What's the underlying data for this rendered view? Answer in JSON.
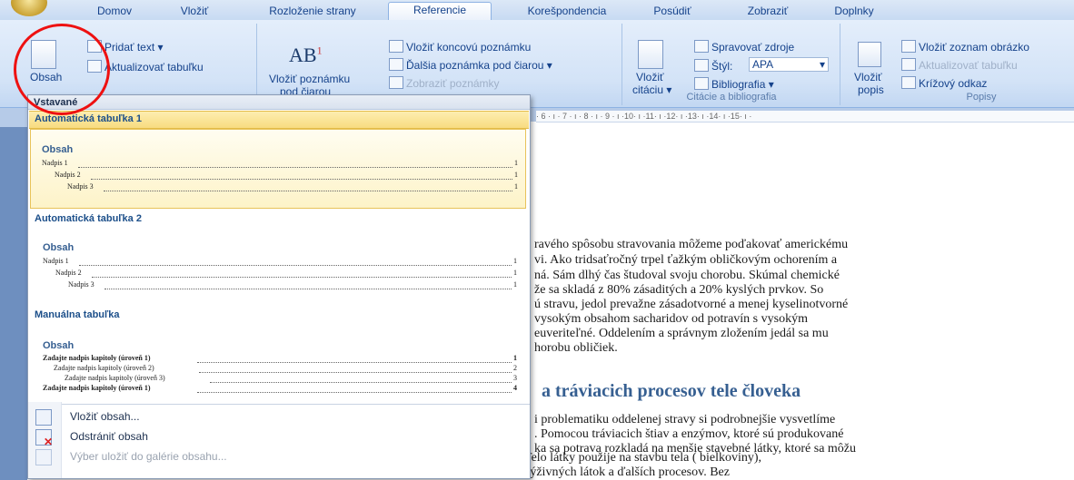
{
  "tabs": [
    "Domov",
    "Vložiť",
    "Rozloženie strany",
    "Referencie",
    "Korešpondencia",
    "Posúdiť",
    "Zobraziť",
    "Doplnky"
  ],
  "ribbon": {
    "obsah_label": "Obsah",
    "pridat_text": "Pridať text ▾",
    "aktualizovat_tabulku": "Aktualizovať tabuľku",
    "ab_glyph": "AB",
    "ab_sup": "1",
    "vlozit_poznamku_1": "Vložiť poznámku",
    "vlozit_poznamku_2": "pod čiarou",
    "vlozit_koncovu": "Vložiť koncovú poznámku",
    "dalsia_poznamka": "Ďalšia poznámka pod čiarou ▾",
    "zobrazit_poznamky": "Zobraziť poznámky",
    "vlozit_citaciu_1": "Vložiť",
    "vlozit_citaciu_2": "citáciu ▾",
    "spravovat_zdroje": "Spravovať zdroje",
    "styl_label": "Štýl:",
    "styl_value": "APA",
    "bibliografia": "Bibliografia ▾",
    "citacie_group": "Citácie a bibliografia",
    "vlozit_popis_1": "Vložiť",
    "vlozit_popis_2": "popis",
    "vlozit_zoznam": "Vložiť zoznam obrázko",
    "aktualizovat_tabulku_2": "Aktualizovať tabuľku",
    "krizovy_odkaz": "Krížový odkaz",
    "popisy_group": "Popisy"
  },
  "ruler_text": "· 6 · ı · 7 · ı · 8 · ı · 9 · ı ·10· ı ·11· ı ·12· ı ·13· ı ·14· ı ·15· ı ·",
  "dropdown": {
    "header": "Vstavané",
    "sections": [
      {
        "title": "Automatická tabuľka 1",
        "toc_title": "Obsah",
        "lines": [
          "Nadpis 1",
          "Nadpis 2",
          "Nadpis 3"
        ]
      },
      {
        "title": "Automatická tabuľka 2",
        "toc_title": "Obsah",
        "lines": [
          "Nadpis 1",
          "Nadpis 2",
          "Nadpis 3"
        ]
      },
      {
        "title": "Manuálna tabuľka",
        "toc_title": "Obsah",
        "lines": [
          "Zadajte nadpis kapitoly (úroveň 1)",
          "Zadajte nadpis kapitoly (úroveň 2)",
          "Zadajte nadpis kapitoly (úroveň 3)",
          "Zadajte nadpis kapitoly (úroveň 1)"
        ],
        "nums": [
          "1",
          "2",
          "3",
          "4"
        ]
      }
    ],
    "page_num": "1",
    "menu": [
      "Vložiť obsah...",
      "Odstrániť obsah",
      "Výber uložiť do galérie obsahu..."
    ]
  },
  "document": {
    "lines": [
      "ravého spôsobu stravovania môžeme poďakovať americkému",
      "vi. Ako tridsaťročný trpel ťažkým obličkovým ochorením a",
      "ná. Sám dlhý čas študoval svoju chorobu. Skúmal chemické",
      "že sa skladá z 80% zásaditých a 20% kyslých prvkov. So",
      "ú stravu, jedol prevažne zásadotvorné a menej kyselinotvorné",
      "vysokým obsahom sacharidov od potravín s vysokým",
      "euveriteľné. Oddelením a správnym zložením jedál sa mu",
      "horobu obličiek."
    ],
    "heading": "a tráviacich procesov tele človeka",
    "lines2": [
      "i problematiku oddelenej stravy si podrobnejšie vysvetlíme",
      ". Pomocou tráviacich štiav a enzýmov, ktoré sú produkované",
      "ka sa potrava rozkladá na menšie stavebné látky, ktoré sa môžu",
      "transportovať napr. z tenkého čreva do pečene. Telo látky použije na stavbu tela ( bielkoviny),",
      "na získanie energie ( tuky, sacharidy), získanie výživných látok a ďalších procesov. Bez"
    ]
  },
  "colors": {
    "accent": "#15428b",
    "highlight": "#f8dc80",
    "annotation": "#e11111"
  }
}
